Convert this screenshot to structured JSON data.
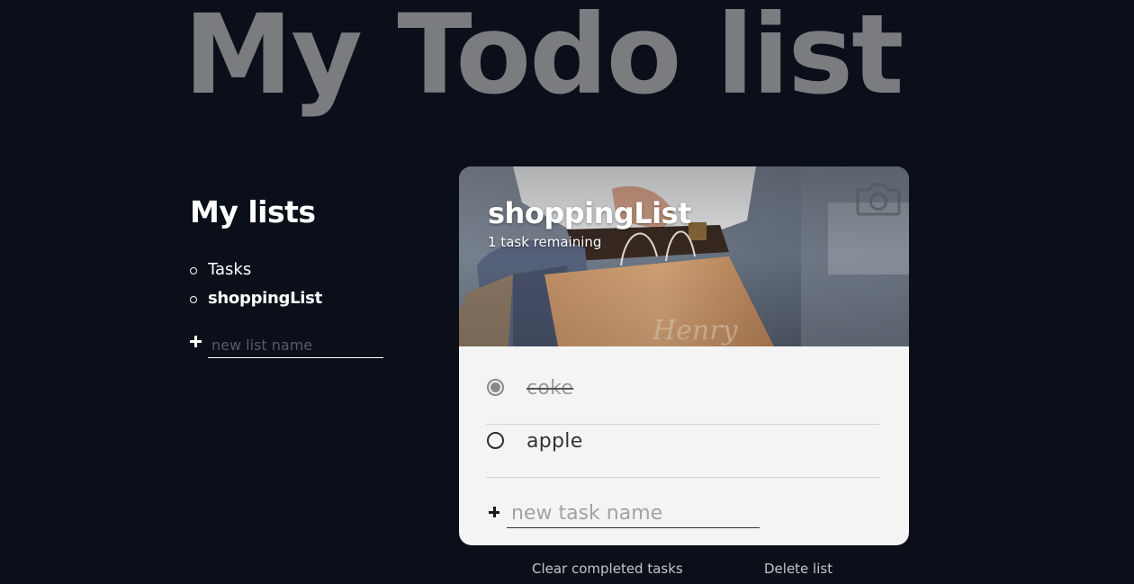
{
  "app": {
    "title": "My Todo list"
  },
  "sidebar": {
    "heading": "My lists",
    "items": [
      {
        "label": "Tasks",
        "active": false
      },
      {
        "label": "shoppingList",
        "active": true
      }
    ],
    "new_list_placeholder": "new list name",
    "add_icon": "plus-icon"
  },
  "active_list": {
    "name": "shoppingList",
    "remaining_text": "1 task remaining",
    "header_icon": "camera-icon",
    "tasks": [
      {
        "label": "coke",
        "completed": true
      },
      {
        "label": "apple",
        "completed": false
      }
    ],
    "new_task_placeholder": "new task name",
    "add_icon": "plus-icon"
  },
  "actions": {
    "clear_completed": "Clear completed tasks",
    "delete_list": "Delete list"
  },
  "colors": {
    "background": "#0a0f19",
    "title": "#7a7c80",
    "card": "#f4f4f4",
    "action_text": "#c4c6ca"
  }
}
